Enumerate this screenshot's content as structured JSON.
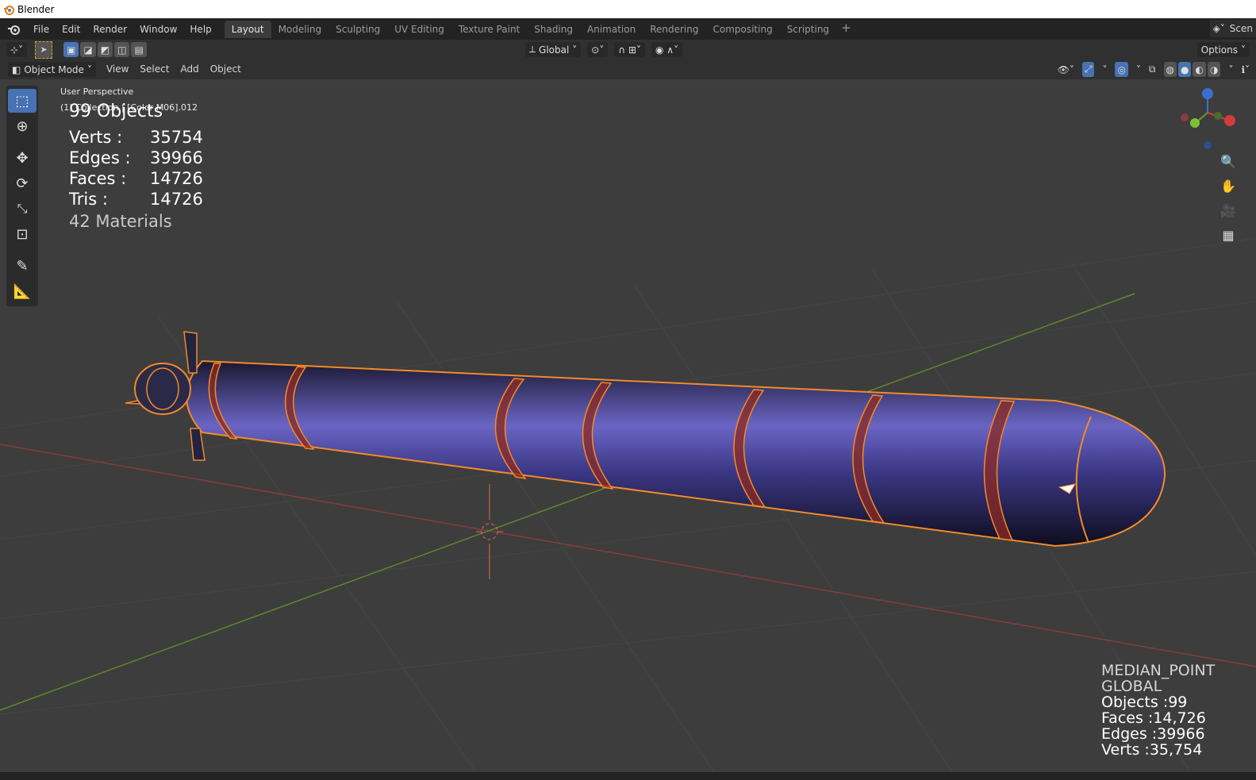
{
  "window": {
    "title": "Blender"
  },
  "menu": [
    "File",
    "Edit",
    "Render",
    "Window",
    "Help"
  ],
  "workspaces": [
    {
      "label": "Layout",
      "active": true
    },
    {
      "label": "Modeling"
    },
    {
      "label": "Sculpting"
    },
    {
      "label": "UV Editing"
    },
    {
      "label": "Texture Paint"
    },
    {
      "label": "Shading"
    },
    {
      "label": "Animation"
    },
    {
      "label": "Rendering"
    },
    {
      "label": "Compositing"
    },
    {
      "label": "Scripting"
    }
  ],
  "scene_label": "Scen",
  "tool_header": {
    "orientation": "Global",
    "options": "Options"
  },
  "viewport_header": {
    "mode": "Object Mode",
    "menus": [
      "View",
      "Select",
      "Add",
      "Object"
    ]
  },
  "overlay": {
    "perspective": "User Perspective",
    "collection": "(1) Collection | [Color M06].012"
  },
  "stats": {
    "title": "99 Objects",
    "rows": [
      {
        "label": "Verts :",
        "value": "35754"
      },
      {
        "label": "Edges :",
        "value": "39966"
      },
      {
        "label": "Faces :",
        "value": "14726"
      },
      {
        "label": "Tris :",
        "value": "14726"
      }
    ],
    "materials": "42 Materials"
  },
  "bottom_right_stats": {
    "pivot": "MEDIAN_POINT",
    "orientation": "GLOBAL",
    "objects": "Objects :99",
    "faces": "Faces :14,726",
    "edges": "Edges :39966",
    "verts": "Verts :35,754"
  },
  "colors": {
    "accent": "#4772b3",
    "selection_outline": "#f28a2a",
    "model_body": "#5a55b8",
    "band": "#a33020"
  },
  "icons": [
    "blender-logo-icon",
    "select-box-icon",
    "cursor-icon",
    "move-icon",
    "rotate-icon",
    "scale-icon",
    "transform-icon",
    "annotate-icon",
    "measure-icon",
    "zoom-icon",
    "hand-pan-icon",
    "camera-icon",
    "grid-ortho-icon"
  ]
}
